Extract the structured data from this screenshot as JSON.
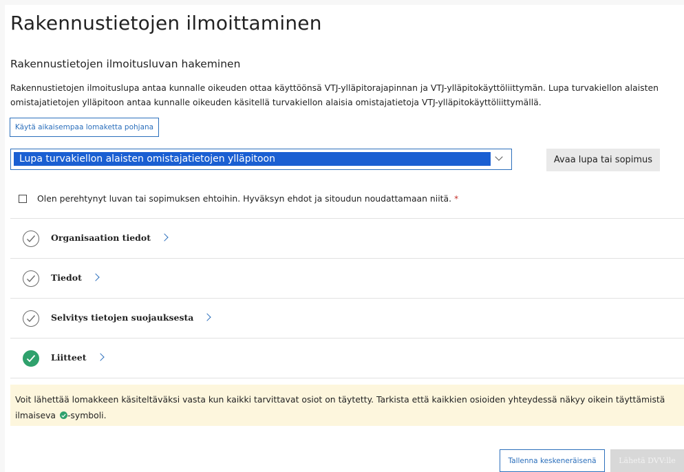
{
  "page": {
    "title": "Rakennustietojen ilmoittaminen",
    "subtitle": "Rakennustietojen ilmoitusluvan hakeminen",
    "intro": "Rakennustietojen ilmoituslupa antaa kunnalle oikeuden ottaa käyttöönsä VTJ-ylläpitorajapinnan ja VTJ-ylläpitokäyttöliittymän. Lupa turvakiellon alaisten omistajatietojen ylläpitoon antaa kunnalle oikeuden käsitellä turvakiellon alaisia omistajatietoja VTJ-ylläpitokäyttöliittymällä."
  },
  "buttons": {
    "use_previous_form": "Käytä aikaisempaa lomaketta pohjana",
    "open_permit": "Avaa lupa tai sopimus",
    "save_draft": "Tallenna keskeneräisenä",
    "send": "Lähetä DVV:lle"
  },
  "permit_select": {
    "selected": "Lupa turvakiellon alaisten omistajatietojen ylläpitoon"
  },
  "terms": {
    "label": "Olen perehtynyt luvan tai sopimuksen ehtoihin. Hyväksyn ehdot ja sitoudun noudattamaan niitä.",
    "required_mark": "*",
    "checked": false
  },
  "sections": [
    {
      "label": "Organisaation tiedot",
      "status": "unchecked-icon"
    },
    {
      "label": "Tiedot",
      "status": "unchecked-icon"
    },
    {
      "label": "Selvitys tietojen suojauksesta",
      "status": "unchecked-icon"
    },
    {
      "label": "Liitteet",
      "status": "completed-icon"
    }
  ],
  "notice": {
    "text_before": "Voit lähettää lomakkeen käsiteltäväksi vasta kun kaikki tarvittavat osiot on täytetty. Tarkista että kaikkien osioiden yhteydessä näkyy oikein täyttämistä ilmaiseva",
    "text_after": "-symboli."
  },
  "colors": {
    "accent": "#2a6ebb",
    "select_highlight": "#1a5fd2",
    "success": "#2fa16c",
    "notice_bg": "#fdf6dd",
    "required": "#c4302b"
  }
}
